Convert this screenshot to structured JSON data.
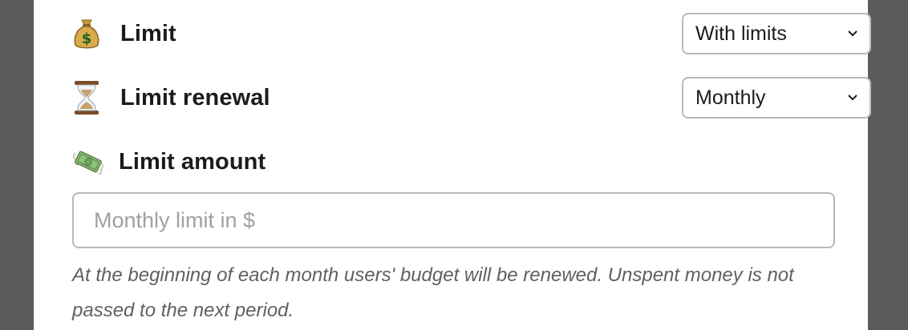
{
  "limit": {
    "icon": "money-bag-icon",
    "label": "Limit",
    "select_value": "With limits"
  },
  "renewal": {
    "icon": "hourglass-icon",
    "label": "Limit renewal",
    "select_value": "Monthly"
  },
  "amount": {
    "icon": "money-with-wings-icon",
    "label": "Limit amount",
    "placeholder": "Monthly limit in $",
    "value": ""
  },
  "help_text": "At the beginning of each month users' budget will be renewed. Unspent money is not passed to the next period."
}
